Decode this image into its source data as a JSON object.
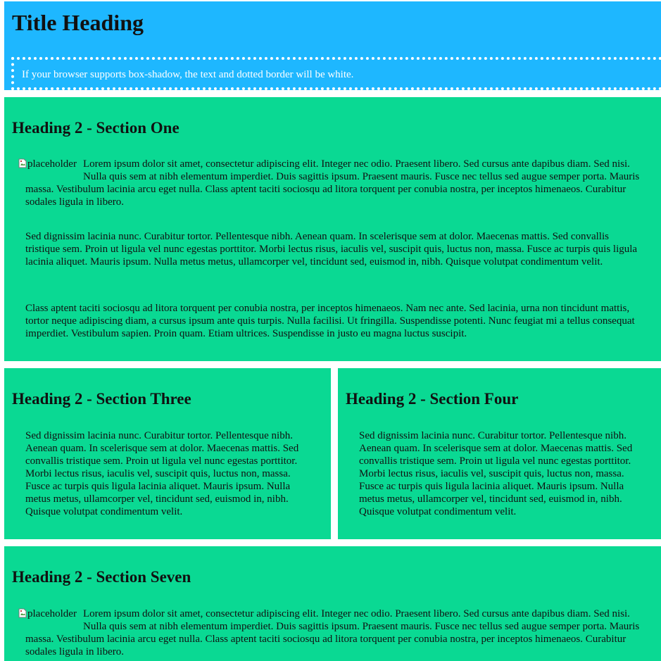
{
  "header": {
    "title": "Title Heading",
    "notice": "If your browser supports box-shadow, the text and dotted border will be white."
  },
  "colors": {
    "header_bg": "#1eb7ff",
    "section_bg": "#0ad993",
    "notice_text": "#ffffff"
  },
  "sections": {
    "one": {
      "heading": "Heading 2 - Section One",
      "image_alt": "placeholder",
      "image_icon": "broken-image-icon",
      "paragraphs": [
        "Lorem ipsum dolor sit amet, consectetur adipiscing elit. Integer nec odio. Praesent libero. Sed cursus ante dapibus diam. Sed nisi. Nulla quis sem at nibh elementum imperdiet. Duis sagittis ipsum. Praesent mauris. Fusce nec tellus sed augue semper porta. Mauris massa. Vestibulum lacinia arcu eget nulla. Class aptent taciti sociosqu ad litora torquent per conubia nostra, per inceptos himenaeos. Curabitur sodales ligula in libero.",
        "Sed dignissim lacinia nunc. Curabitur tortor. Pellentesque nibh. Aenean quam. In scelerisque sem at dolor. Maecenas mattis. Sed convallis tristique sem. Proin ut ligula vel nunc egestas porttitor. Morbi lectus risus, iaculis vel, suscipit quis, luctus non, massa. Fusce ac turpis quis ligula lacinia aliquet. Mauris ipsum. Nulla metus metus, ullamcorper vel, tincidunt sed, euismod in, nibh. Quisque volutpat condimentum velit.",
        "Class aptent taciti sociosqu ad litora torquent per conubia nostra, per inceptos himenaeos. Nam nec ante. Sed lacinia, urna non tincidunt mattis, tortor neque adipiscing diam, a cursus ipsum ante quis turpis. Nulla facilisi. Ut fringilla. Suspendisse potenti. Nunc feugiat mi a tellus consequat imperdiet. Vestibulum sapien. Proin quam. Etiam ultrices. Suspendisse in justo eu magna luctus suscipit."
      ]
    },
    "three": {
      "heading": "Heading 2 - Section Three",
      "paragraph": "Sed dignissim lacinia nunc. Curabitur tortor. Pellentesque nibh. Aenean quam. In scelerisque sem at dolor. Maecenas mattis. Sed convallis tristique sem. Proin ut ligula vel nunc egestas porttitor. Morbi lectus risus, iaculis vel, suscipit quis, luctus non, massa. Fusce ac turpis quis ligula lacinia aliquet. Mauris ipsum. Nulla metus metus, ullamcorper vel, tincidunt sed, euismod in, nibh. Quisque volutpat condimentum velit."
    },
    "four": {
      "heading": "Heading 2 - Section Four",
      "paragraph": "Sed dignissim lacinia nunc. Curabitur tortor. Pellentesque nibh. Aenean quam. In scelerisque sem at dolor. Maecenas mattis. Sed convallis tristique sem. Proin ut ligula vel nunc egestas porttitor. Morbi lectus risus, iaculis vel, suscipit quis, luctus non, massa. Fusce ac turpis quis ligula lacinia aliquet. Mauris ipsum. Nulla metus metus, ullamcorper vel, tincidunt sed, euismod in, nibh. Quisque volutpat condimentum velit."
    },
    "seven": {
      "heading": "Heading 2 - Section Seven",
      "image_alt": "placeholder",
      "image_icon": "broken-image-icon",
      "paragraph": "Lorem ipsum dolor sit amet, consectetur adipiscing elit. Integer nec odio. Praesent libero. Sed cursus ante dapibus diam. Sed nisi. Nulla quis sem at nibh elementum imperdiet. Duis sagittis ipsum. Praesent mauris. Fusce nec tellus sed augue semper porta. Mauris massa. Vestibulum lacinia arcu eget nulla. Class aptent taciti sociosqu ad litora torquent per conubia nostra, per inceptos himenaeos. Curabitur sodales ligula in libero."
    }
  }
}
